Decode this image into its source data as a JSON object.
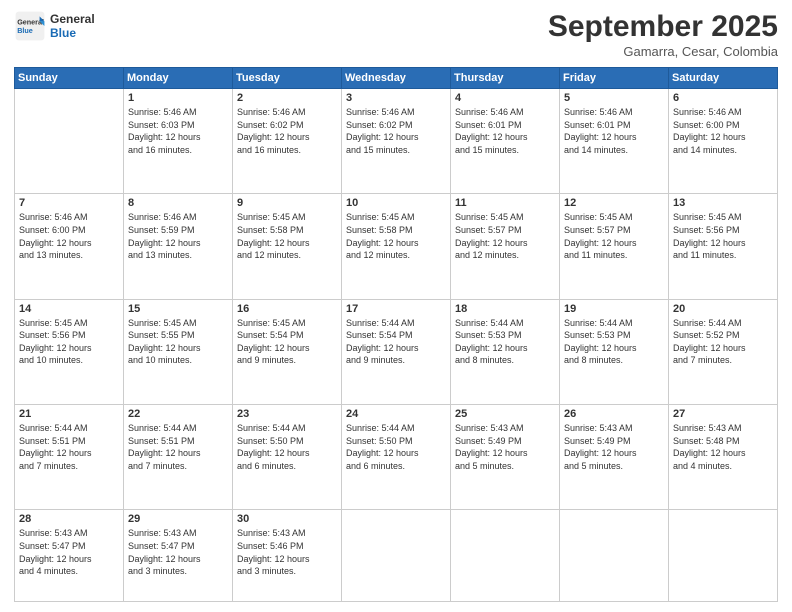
{
  "header": {
    "logo_general": "General",
    "logo_blue": "Blue",
    "month_year": "September 2025",
    "location": "Gamarra, Cesar, Colombia"
  },
  "days_of_week": [
    "Sunday",
    "Monday",
    "Tuesday",
    "Wednesday",
    "Thursday",
    "Friday",
    "Saturday"
  ],
  "weeks": [
    [
      {
        "day": "",
        "info": ""
      },
      {
        "day": "1",
        "info": "Sunrise: 5:46 AM\nSunset: 6:03 PM\nDaylight: 12 hours\nand 16 minutes."
      },
      {
        "day": "2",
        "info": "Sunrise: 5:46 AM\nSunset: 6:02 PM\nDaylight: 12 hours\nand 16 minutes."
      },
      {
        "day": "3",
        "info": "Sunrise: 5:46 AM\nSunset: 6:02 PM\nDaylight: 12 hours\nand 15 minutes."
      },
      {
        "day": "4",
        "info": "Sunrise: 5:46 AM\nSunset: 6:01 PM\nDaylight: 12 hours\nand 15 minutes."
      },
      {
        "day": "5",
        "info": "Sunrise: 5:46 AM\nSunset: 6:01 PM\nDaylight: 12 hours\nand 14 minutes."
      },
      {
        "day": "6",
        "info": "Sunrise: 5:46 AM\nSunset: 6:00 PM\nDaylight: 12 hours\nand 14 minutes."
      }
    ],
    [
      {
        "day": "7",
        "info": "Sunrise: 5:46 AM\nSunset: 6:00 PM\nDaylight: 12 hours\nand 13 minutes."
      },
      {
        "day": "8",
        "info": "Sunrise: 5:46 AM\nSunset: 5:59 PM\nDaylight: 12 hours\nand 13 minutes."
      },
      {
        "day": "9",
        "info": "Sunrise: 5:45 AM\nSunset: 5:58 PM\nDaylight: 12 hours\nand 12 minutes."
      },
      {
        "day": "10",
        "info": "Sunrise: 5:45 AM\nSunset: 5:58 PM\nDaylight: 12 hours\nand 12 minutes."
      },
      {
        "day": "11",
        "info": "Sunrise: 5:45 AM\nSunset: 5:57 PM\nDaylight: 12 hours\nand 12 minutes."
      },
      {
        "day": "12",
        "info": "Sunrise: 5:45 AM\nSunset: 5:57 PM\nDaylight: 12 hours\nand 11 minutes."
      },
      {
        "day": "13",
        "info": "Sunrise: 5:45 AM\nSunset: 5:56 PM\nDaylight: 12 hours\nand 11 minutes."
      }
    ],
    [
      {
        "day": "14",
        "info": "Sunrise: 5:45 AM\nSunset: 5:56 PM\nDaylight: 12 hours\nand 10 minutes."
      },
      {
        "day": "15",
        "info": "Sunrise: 5:45 AM\nSunset: 5:55 PM\nDaylight: 12 hours\nand 10 minutes."
      },
      {
        "day": "16",
        "info": "Sunrise: 5:45 AM\nSunset: 5:54 PM\nDaylight: 12 hours\nand 9 minutes."
      },
      {
        "day": "17",
        "info": "Sunrise: 5:44 AM\nSunset: 5:54 PM\nDaylight: 12 hours\nand 9 minutes."
      },
      {
        "day": "18",
        "info": "Sunrise: 5:44 AM\nSunset: 5:53 PM\nDaylight: 12 hours\nand 8 minutes."
      },
      {
        "day": "19",
        "info": "Sunrise: 5:44 AM\nSunset: 5:53 PM\nDaylight: 12 hours\nand 8 minutes."
      },
      {
        "day": "20",
        "info": "Sunrise: 5:44 AM\nSunset: 5:52 PM\nDaylight: 12 hours\nand 7 minutes."
      }
    ],
    [
      {
        "day": "21",
        "info": "Sunrise: 5:44 AM\nSunset: 5:51 PM\nDaylight: 12 hours\nand 7 minutes."
      },
      {
        "day": "22",
        "info": "Sunrise: 5:44 AM\nSunset: 5:51 PM\nDaylight: 12 hours\nand 7 minutes."
      },
      {
        "day": "23",
        "info": "Sunrise: 5:44 AM\nSunset: 5:50 PM\nDaylight: 12 hours\nand 6 minutes."
      },
      {
        "day": "24",
        "info": "Sunrise: 5:44 AM\nSunset: 5:50 PM\nDaylight: 12 hours\nand 6 minutes."
      },
      {
        "day": "25",
        "info": "Sunrise: 5:43 AM\nSunset: 5:49 PM\nDaylight: 12 hours\nand 5 minutes."
      },
      {
        "day": "26",
        "info": "Sunrise: 5:43 AM\nSunset: 5:49 PM\nDaylight: 12 hours\nand 5 minutes."
      },
      {
        "day": "27",
        "info": "Sunrise: 5:43 AM\nSunset: 5:48 PM\nDaylight: 12 hours\nand 4 minutes."
      }
    ],
    [
      {
        "day": "28",
        "info": "Sunrise: 5:43 AM\nSunset: 5:47 PM\nDaylight: 12 hours\nand 4 minutes."
      },
      {
        "day": "29",
        "info": "Sunrise: 5:43 AM\nSunset: 5:47 PM\nDaylight: 12 hours\nand 3 minutes."
      },
      {
        "day": "30",
        "info": "Sunrise: 5:43 AM\nSunset: 5:46 PM\nDaylight: 12 hours\nand 3 minutes."
      },
      {
        "day": "",
        "info": ""
      },
      {
        "day": "",
        "info": ""
      },
      {
        "day": "",
        "info": ""
      },
      {
        "day": "",
        "info": ""
      }
    ]
  ]
}
